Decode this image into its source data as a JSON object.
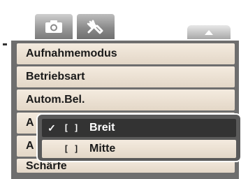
{
  "tabs": {
    "camera_icon": "camera-icon",
    "setup_icon": "wrench-icon"
  },
  "scroll": {
    "icon": "arrow-up-icon"
  },
  "menu": {
    "items": [
      {
        "label": "Aufnahmemodus"
      },
      {
        "label": "Betriebsart"
      },
      {
        "label": "Autom.Bel."
      },
      {
        "label": "A"
      },
      {
        "label": "A"
      },
      {
        "label": "Schärfe"
      }
    ]
  },
  "submenu": {
    "items": [
      {
        "check": "✓",
        "bracket": "[  ]",
        "label": "Breit",
        "selected": true
      },
      {
        "check": "",
        "bracket": "[  ]",
        "label": "Mitte",
        "selected": false
      }
    ]
  },
  "colors": {
    "menu_bg": "#6e6e6e",
    "item_bg": "#efe5d8",
    "selected_bg": "#333333"
  }
}
